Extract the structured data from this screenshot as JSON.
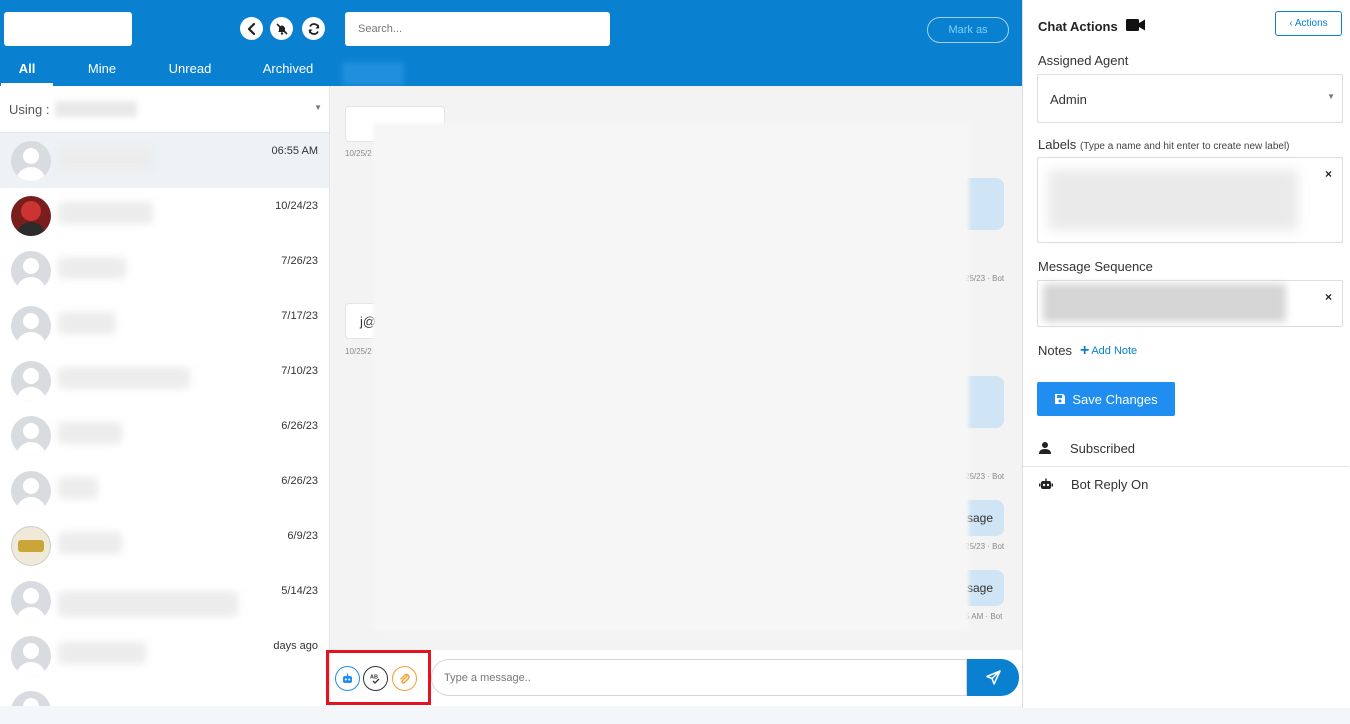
{
  "header": {
    "search_placeholder": "Search...",
    "mark_as_label": "Mark as",
    "icons": [
      "back-icon",
      "mute-icon",
      "refresh-icon"
    ]
  },
  "tabs": [
    {
      "label": "All",
      "active": true
    },
    {
      "label": "Mine",
      "active": false
    },
    {
      "label": "Unread",
      "active": false
    },
    {
      "label": "Archived",
      "active": false
    }
  ],
  "contacts_panel": {
    "using_label": "Using :",
    "contacts": [
      {
        "date": "06:55 AM",
        "selected": true
      },
      {
        "date": "10/24/23",
        "selected": false
      },
      {
        "date": "7/26/23",
        "selected": false
      },
      {
        "date": "7/17/23",
        "selected": false
      },
      {
        "date": "7/10/23",
        "selected": false
      },
      {
        "date": "6/26/23",
        "selected": false
      },
      {
        "date": "6/26/23",
        "selected": false
      },
      {
        "date": "6/9/23",
        "selected": false
      },
      {
        "date": "5/14/23",
        "selected": false
      },
      {
        "date": "days ago",
        "selected": false
      }
    ]
  },
  "chat": {
    "messages": [
      {
        "text": "",
        "meta": "10/25/2"
      },
      {
        "text": "",
        "meta": "25/23 · Bot"
      },
      {
        "text": "j@",
        "meta": "10/25/2"
      },
      {
        "text": "",
        "meta": "25/23 · Bot"
      },
      {
        "text": "sage",
        "meta": "25/23 · Bot"
      },
      {
        "text": "sage",
        "meta": "5 AM · Bot"
      }
    ],
    "composer_placeholder": "Type a message..",
    "tool_icons": [
      "bot-icon",
      "spellcheck-icon",
      "attachment-icon"
    ]
  },
  "right_panel": {
    "title": "Chat Actions",
    "actions_button": "‹ Actions",
    "assigned_agent_label": "Assigned Agent",
    "assigned_agent_value": "Admin",
    "labels_label": "Labels",
    "labels_hint": "(Type a name and hit enter to create new label)",
    "message_sequence_label": "Message Sequence",
    "notes_label": "Notes",
    "add_note_label": "Add Note",
    "save_button": "Save Changes",
    "subscribed_label": "Subscribed",
    "bot_reply_label": "Bot Reply On",
    "remove_symbol": "×"
  },
  "colors": {
    "primary": "#0a80d0",
    "save_button": "#1f8ef0",
    "highlight": "#e3141f"
  }
}
